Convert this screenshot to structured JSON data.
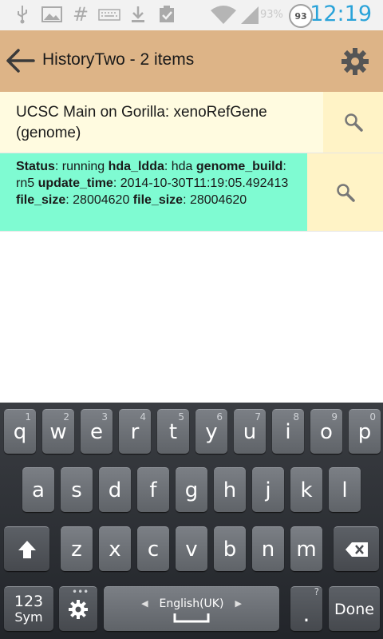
{
  "status_bar": {
    "time": "12:19",
    "battery_level": "93",
    "battery_percent_text": "93%",
    "icons": [
      "usb-icon",
      "image-icon",
      "hash-icon",
      "keyboard-icon",
      "download-icon",
      "clipboard-check-icon",
      "wifi-icon",
      "signal-icon"
    ]
  },
  "action_bar": {
    "title": "HistoryTwo - 2 items"
  },
  "list": {
    "item1": {
      "text": "UCSC Main on Gorilla: xenoRefGene (genome)"
    },
    "item2": {
      "status_label": "Status",
      "status_value": ": running ",
      "hda_label": "hda_ldda",
      "hda_value": ": hda",
      "genome_label": "genome_build",
      "genome_value": ": rn5 ",
      "update_label": "update_time",
      "update_value": ": 2014-10-30T11:19:05.492413 ",
      "size_label": "file_size",
      "size_value": ": 28004620 ",
      "size_label2": "file_size",
      "size_value2": ": 28004620"
    }
  },
  "keyboard": {
    "row1": [
      {
        "key": "q",
        "hint": "1"
      },
      {
        "key": "w",
        "hint": "2"
      },
      {
        "key": "e",
        "hint": "3"
      },
      {
        "key": "r",
        "hint": "4"
      },
      {
        "key": "t",
        "hint": "5"
      },
      {
        "key": "y",
        "hint": "6"
      },
      {
        "key": "u",
        "hint": "7"
      },
      {
        "key": "i",
        "hint": "8"
      },
      {
        "key": "o",
        "hint": "9"
      },
      {
        "key": "p",
        "hint": "0"
      }
    ],
    "row2": [
      "a",
      "s",
      "d",
      "f",
      "g",
      "h",
      "j",
      "k",
      "l"
    ],
    "row3": [
      "z",
      "x",
      "c",
      "v",
      "b",
      "n",
      "m"
    ],
    "sym_label_top": "123",
    "sym_label_bottom": "Sym",
    "space_label": "English(UK)",
    "period_label": ".",
    "period_hint": "?",
    "done_label": "Done"
  },
  "colors": {
    "action_bar": "#ddb487",
    "row1_bg": "#fffbe0",
    "row2_bg": "#7ffbd2",
    "search_bg": "#fff3c6",
    "clock": "#2aa3d9"
  }
}
